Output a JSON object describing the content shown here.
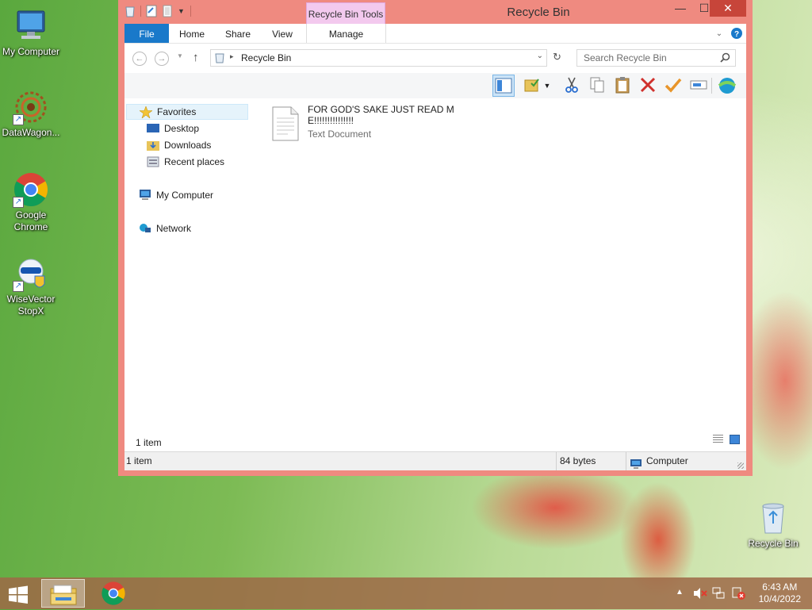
{
  "desktop": {
    "icons": [
      {
        "label": "My Computer",
        "icon": "computer-icon"
      },
      {
        "label": "DataWagon...",
        "icon": "datawagon-icon"
      },
      {
        "label": "Google Chrome",
        "icon": "chrome-icon"
      },
      {
        "label": "WiseVector StopX",
        "icon": "wisevector-icon"
      },
      {
        "label": "Recycle Bin",
        "icon": "recycle-bin-icon"
      }
    ]
  },
  "window": {
    "title": "Recycle Bin",
    "context_tab": "Recycle Bin Tools",
    "ribbon_tabs": [
      "File",
      "Home",
      "Share",
      "View",
      "Manage"
    ],
    "address": "Recycle Bin",
    "search_placeholder": "Search Recycle Bin",
    "controls": {
      "minimize": "—",
      "maximize": "☐",
      "close": "✕"
    },
    "nav": {
      "favorites": "Favorites",
      "desktop": "Desktop",
      "downloads": "Downloads",
      "recent": "Recent places",
      "computer": "My Computer",
      "network": "Network"
    },
    "file": {
      "name": "FOR GOD'S SAKE JUST READ ME!!!!!!!!!!!!!!!",
      "type": "Text Document"
    },
    "item_count": "1 item",
    "status": {
      "items": "1 item",
      "size": "84 bytes",
      "location": "Computer"
    }
  },
  "taskbar": {
    "time": "6:43 AM",
    "date": "10/4/2022"
  },
  "colors": {
    "accent": "#1979ca",
    "window_frame": "#ef8a80",
    "context_tab": "#f3c9ee",
    "close_button": "#c7453a"
  }
}
